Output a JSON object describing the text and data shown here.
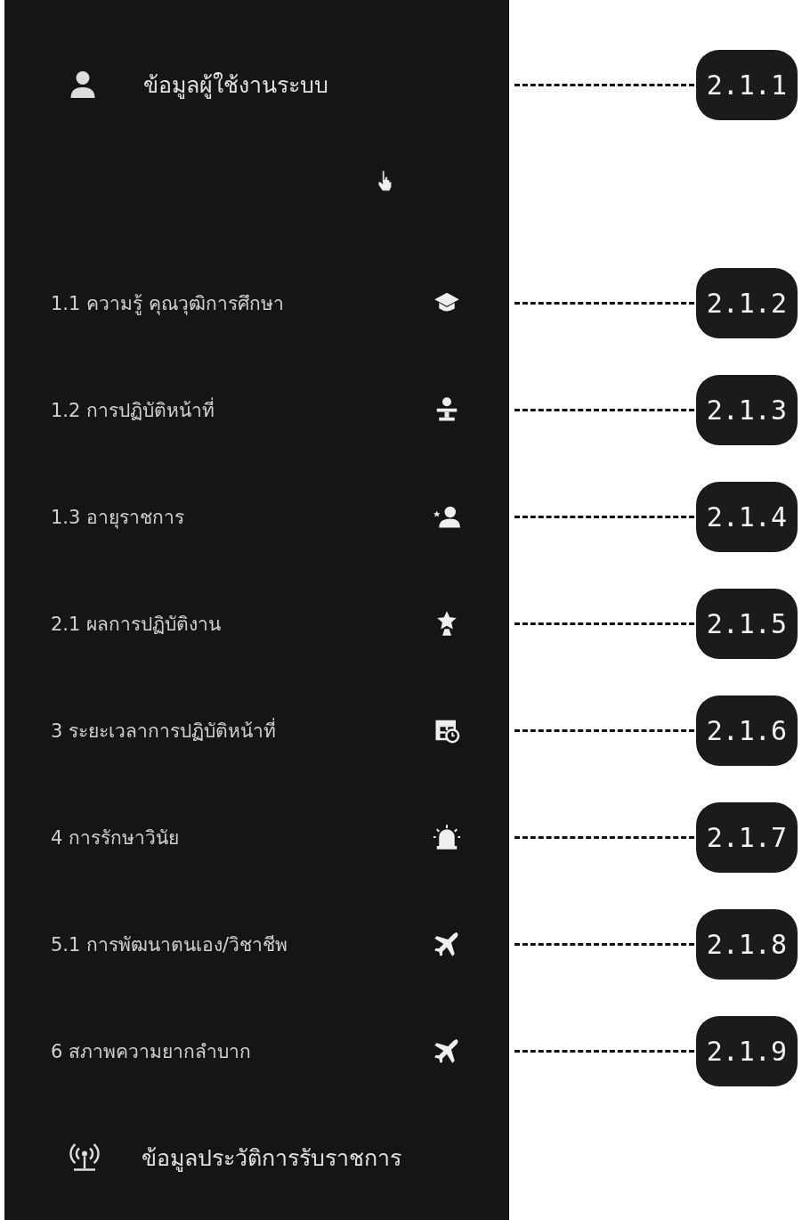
{
  "sidebar": {
    "header": {
      "label": "ข้อมูลผู้ใช้งานระบบ",
      "callout": "2.1.1"
    },
    "items": [
      {
        "label": "1.1 ความรู้ คุณวุฒิการศึกษา",
        "callout": "2.1.2"
      },
      {
        "label": "1.2 การปฏิบัติหน้าที่",
        "callout": "2.1.3"
      },
      {
        "label": "1.3 อายุราชการ",
        "callout": "2.1.4"
      },
      {
        "label": "2.1 ผลการปฏิบัติงาน",
        "callout": "2.1.5"
      },
      {
        "label": "3 ระยะเวลาการปฏิบัติหน้าที่",
        "callout": "2.1.6"
      },
      {
        "label": "4 การรักษาวินัย",
        "callout": "2.1.7"
      },
      {
        "label": "5.1 การพัฒนาตนเอง/วิชาชีพ",
        "callout": "2.1.8"
      },
      {
        "label": "6 สภาพความยากลำบาก",
        "callout": "2.1.9"
      }
    ],
    "footer": {
      "label": "ข้อมูลประวัติการรับราชการ"
    }
  }
}
